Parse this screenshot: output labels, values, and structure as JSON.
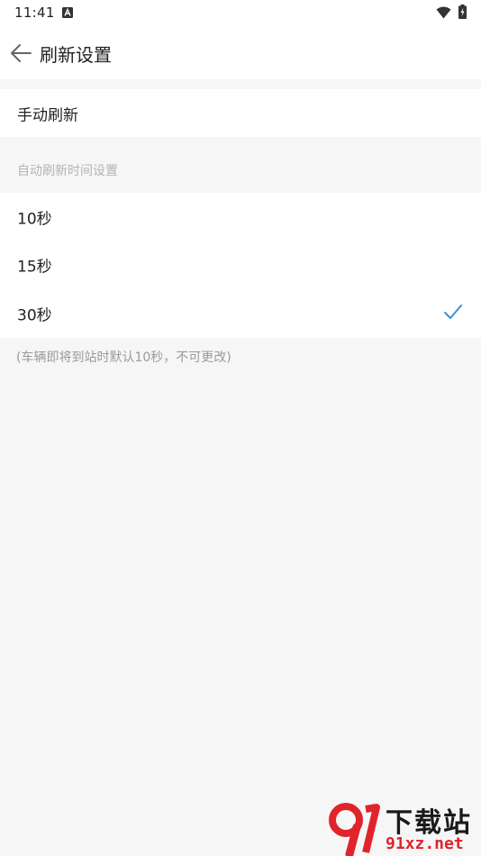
{
  "status_bar": {
    "time": "11:41",
    "icons": [
      "a-notification-icon",
      "wifi-icon",
      "battery-icon"
    ]
  },
  "app_bar": {
    "back_icon": "arrow-left-icon",
    "title": "刷新设置"
  },
  "manual_refresh": {
    "label": "手动刷新"
  },
  "auto_refresh": {
    "section_title": "自动刷新时间设置",
    "options": [
      {
        "label": "10秒",
        "selected": false
      },
      {
        "label": "15秒",
        "selected": false
      },
      {
        "label": "30秒",
        "selected": true
      }
    ],
    "footnote": "(车辆即将到站时默认10秒，不可更改)"
  },
  "watermark": {
    "logo_text": "91",
    "text_top": "下载站",
    "text_bottom": "91xz.net"
  },
  "colors": {
    "background": "#f6f6f6",
    "surface": "#ffffff",
    "text_primary": "#222222",
    "text_secondary": "#b4b4b4",
    "accent_check": "#3d8fd1",
    "watermark_red": "#e0242b"
  }
}
